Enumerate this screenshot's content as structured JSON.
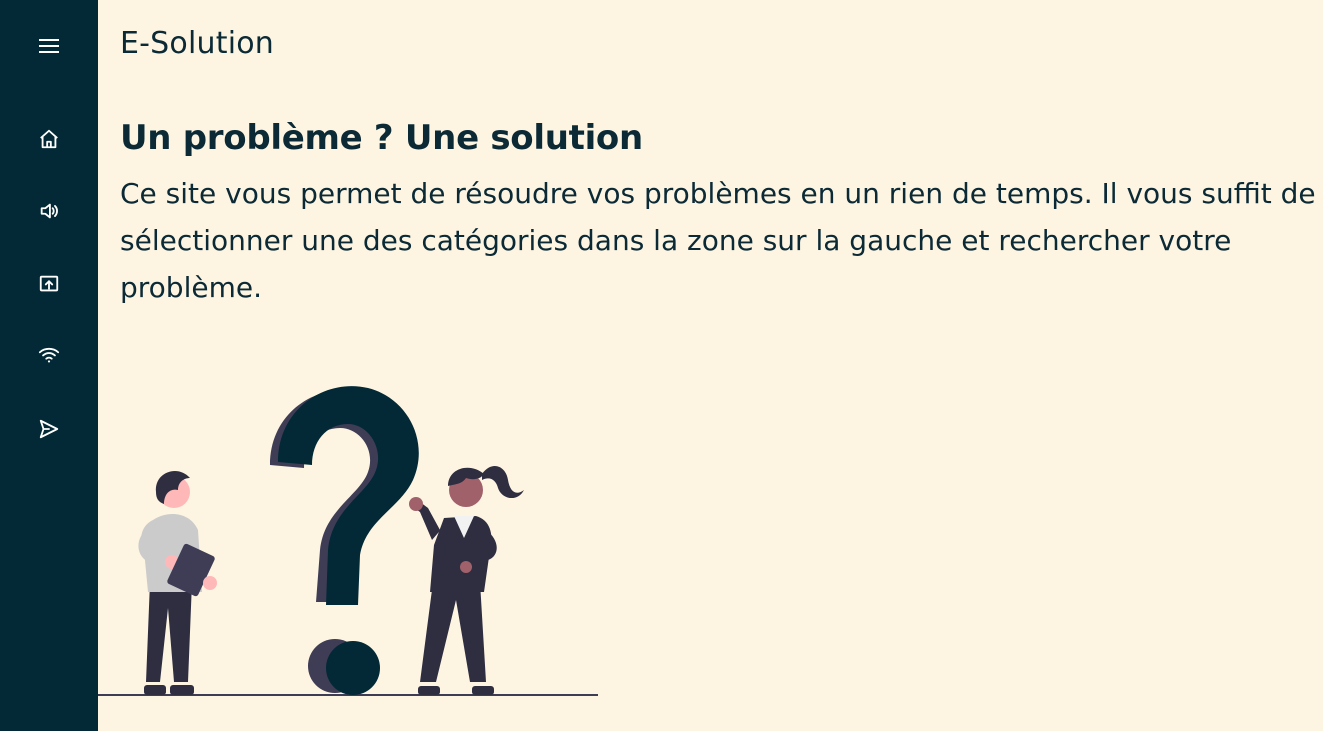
{
  "sidebar": {
    "items": [
      {
        "icon": "menu-icon"
      },
      {
        "icon": "home-icon"
      },
      {
        "icon": "speaker-icon"
      },
      {
        "icon": "screen-share-icon"
      },
      {
        "icon": "wifi-icon"
      },
      {
        "icon": "send-icon"
      }
    ],
    "bg_color": "#032936"
  },
  "header": {
    "title": "E-Solution"
  },
  "main": {
    "heading": "Un problème ? Une solution",
    "description": "Ce site vous permet de résoudre vos problèmes en un rien de temps. Il vous suffit de sélectionner une des catégories dans la zone sur la gauche et rechercher votre problème.",
    "illustration": "people-question-mark-illustration"
  },
  "colors": {
    "background": "#fdf5e2",
    "text": "#0b2a36",
    "accent": "#032936"
  }
}
